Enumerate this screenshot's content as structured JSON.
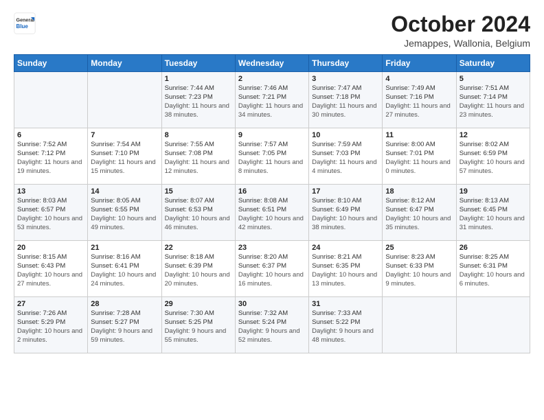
{
  "header": {
    "logo_line1": "General",
    "logo_line2": "Blue",
    "month": "October 2024",
    "location": "Jemappes, Wallonia, Belgium"
  },
  "weekdays": [
    "Sunday",
    "Monday",
    "Tuesday",
    "Wednesday",
    "Thursday",
    "Friday",
    "Saturday"
  ],
  "weeks": [
    [
      {
        "day": "",
        "sunrise": "",
        "sunset": "",
        "daylight": ""
      },
      {
        "day": "",
        "sunrise": "",
        "sunset": "",
        "daylight": ""
      },
      {
        "day": "1",
        "sunrise": "Sunrise: 7:44 AM",
        "sunset": "Sunset: 7:23 PM",
        "daylight": "Daylight: 11 hours and 38 minutes."
      },
      {
        "day": "2",
        "sunrise": "Sunrise: 7:46 AM",
        "sunset": "Sunset: 7:21 PM",
        "daylight": "Daylight: 11 hours and 34 minutes."
      },
      {
        "day": "3",
        "sunrise": "Sunrise: 7:47 AM",
        "sunset": "Sunset: 7:18 PM",
        "daylight": "Daylight: 11 hours and 30 minutes."
      },
      {
        "day": "4",
        "sunrise": "Sunrise: 7:49 AM",
        "sunset": "Sunset: 7:16 PM",
        "daylight": "Daylight: 11 hours and 27 minutes."
      },
      {
        "day": "5",
        "sunrise": "Sunrise: 7:51 AM",
        "sunset": "Sunset: 7:14 PM",
        "daylight": "Daylight: 11 hours and 23 minutes."
      }
    ],
    [
      {
        "day": "6",
        "sunrise": "Sunrise: 7:52 AM",
        "sunset": "Sunset: 7:12 PM",
        "daylight": "Daylight: 11 hours and 19 minutes."
      },
      {
        "day": "7",
        "sunrise": "Sunrise: 7:54 AM",
        "sunset": "Sunset: 7:10 PM",
        "daylight": "Daylight: 11 hours and 15 minutes."
      },
      {
        "day": "8",
        "sunrise": "Sunrise: 7:55 AM",
        "sunset": "Sunset: 7:08 PM",
        "daylight": "Daylight: 11 hours and 12 minutes."
      },
      {
        "day": "9",
        "sunrise": "Sunrise: 7:57 AM",
        "sunset": "Sunset: 7:05 PM",
        "daylight": "Daylight: 11 hours and 8 minutes."
      },
      {
        "day": "10",
        "sunrise": "Sunrise: 7:59 AM",
        "sunset": "Sunset: 7:03 PM",
        "daylight": "Daylight: 11 hours and 4 minutes."
      },
      {
        "day": "11",
        "sunrise": "Sunrise: 8:00 AM",
        "sunset": "Sunset: 7:01 PM",
        "daylight": "Daylight: 11 hours and 0 minutes."
      },
      {
        "day": "12",
        "sunrise": "Sunrise: 8:02 AM",
        "sunset": "Sunset: 6:59 PM",
        "daylight": "Daylight: 10 hours and 57 minutes."
      }
    ],
    [
      {
        "day": "13",
        "sunrise": "Sunrise: 8:03 AM",
        "sunset": "Sunset: 6:57 PM",
        "daylight": "Daylight: 10 hours and 53 minutes."
      },
      {
        "day": "14",
        "sunrise": "Sunrise: 8:05 AM",
        "sunset": "Sunset: 6:55 PM",
        "daylight": "Daylight: 10 hours and 49 minutes."
      },
      {
        "day": "15",
        "sunrise": "Sunrise: 8:07 AM",
        "sunset": "Sunset: 6:53 PM",
        "daylight": "Daylight: 10 hours and 46 minutes."
      },
      {
        "day": "16",
        "sunrise": "Sunrise: 8:08 AM",
        "sunset": "Sunset: 6:51 PM",
        "daylight": "Daylight: 10 hours and 42 minutes."
      },
      {
        "day": "17",
        "sunrise": "Sunrise: 8:10 AM",
        "sunset": "Sunset: 6:49 PM",
        "daylight": "Daylight: 10 hours and 38 minutes."
      },
      {
        "day": "18",
        "sunrise": "Sunrise: 8:12 AM",
        "sunset": "Sunset: 6:47 PM",
        "daylight": "Daylight: 10 hours and 35 minutes."
      },
      {
        "day": "19",
        "sunrise": "Sunrise: 8:13 AM",
        "sunset": "Sunset: 6:45 PM",
        "daylight": "Daylight: 10 hours and 31 minutes."
      }
    ],
    [
      {
        "day": "20",
        "sunrise": "Sunrise: 8:15 AM",
        "sunset": "Sunset: 6:43 PM",
        "daylight": "Daylight: 10 hours and 27 minutes."
      },
      {
        "day": "21",
        "sunrise": "Sunrise: 8:16 AM",
        "sunset": "Sunset: 6:41 PM",
        "daylight": "Daylight: 10 hours and 24 minutes."
      },
      {
        "day": "22",
        "sunrise": "Sunrise: 8:18 AM",
        "sunset": "Sunset: 6:39 PM",
        "daylight": "Daylight: 10 hours and 20 minutes."
      },
      {
        "day": "23",
        "sunrise": "Sunrise: 8:20 AM",
        "sunset": "Sunset: 6:37 PM",
        "daylight": "Daylight: 10 hours and 16 minutes."
      },
      {
        "day": "24",
        "sunrise": "Sunrise: 8:21 AM",
        "sunset": "Sunset: 6:35 PM",
        "daylight": "Daylight: 10 hours and 13 minutes."
      },
      {
        "day": "25",
        "sunrise": "Sunrise: 8:23 AM",
        "sunset": "Sunset: 6:33 PM",
        "daylight": "Daylight: 10 hours and 9 minutes."
      },
      {
        "day": "26",
        "sunrise": "Sunrise: 8:25 AM",
        "sunset": "Sunset: 6:31 PM",
        "daylight": "Daylight: 10 hours and 6 minutes."
      }
    ],
    [
      {
        "day": "27",
        "sunrise": "Sunrise: 7:26 AM",
        "sunset": "Sunset: 5:29 PM",
        "daylight": "Daylight: 10 hours and 2 minutes."
      },
      {
        "day": "28",
        "sunrise": "Sunrise: 7:28 AM",
        "sunset": "Sunset: 5:27 PM",
        "daylight": "Daylight: 9 hours and 59 minutes."
      },
      {
        "day": "29",
        "sunrise": "Sunrise: 7:30 AM",
        "sunset": "Sunset: 5:25 PM",
        "daylight": "Daylight: 9 hours and 55 minutes."
      },
      {
        "day": "30",
        "sunrise": "Sunrise: 7:32 AM",
        "sunset": "Sunset: 5:24 PM",
        "daylight": "Daylight: 9 hours and 52 minutes."
      },
      {
        "day": "31",
        "sunrise": "Sunrise: 7:33 AM",
        "sunset": "Sunset: 5:22 PM",
        "daylight": "Daylight: 9 hours and 48 minutes."
      },
      {
        "day": "",
        "sunrise": "",
        "sunset": "",
        "daylight": ""
      },
      {
        "day": "",
        "sunrise": "",
        "sunset": "",
        "daylight": ""
      }
    ]
  ]
}
